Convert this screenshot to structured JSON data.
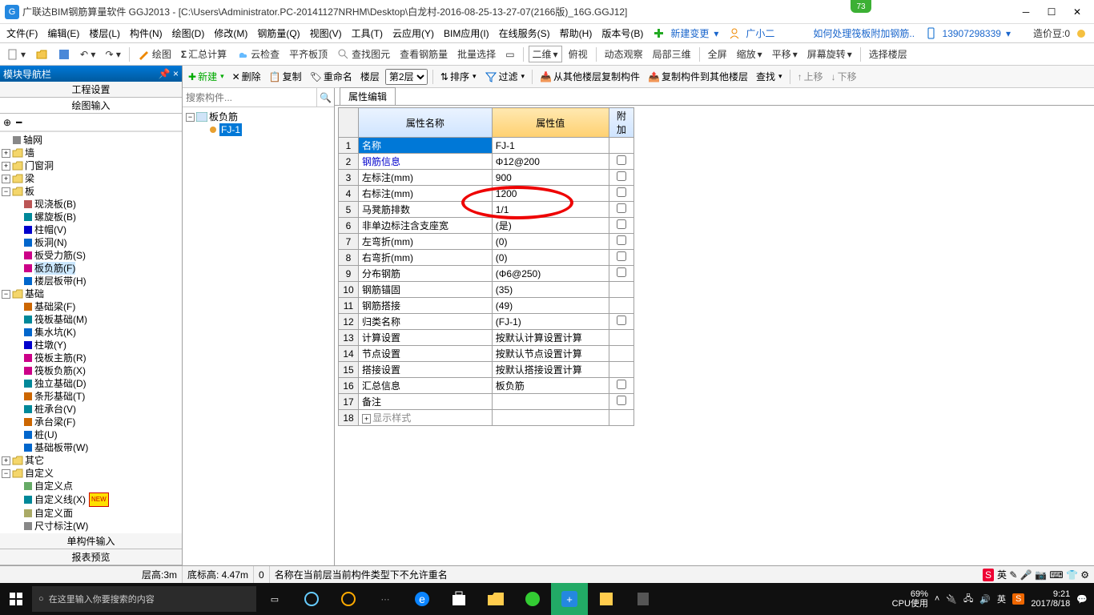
{
  "title": "广联达BIM钢筋算量软件 GGJ2013 - [C:\\Users\\Administrator.PC-20141127NRHM\\Desktop\\白龙村-2016-08-25-13-27-07(2166版)_16G.GGJ12]",
  "badge_top": "73",
  "menu": [
    "文件(F)",
    "编辑(E)",
    "楼层(L)",
    "构件(N)",
    "绘图(D)",
    "修改(M)",
    "钢筋量(Q)",
    "视图(V)",
    "工具(T)",
    "云应用(Y)",
    "BIM应用(I)",
    "在线服务(S)",
    "帮助(H)",
    "版本号(B)"
  ],
  "menu_right": {
    "newchange": "新建变更",
    "user": "广小二",
    "help_link": "如何处理筏板附加钢筋..",
    "phone": "13907298339",
    "beans": "造价豆:0"
  },
  "toolbar1": {
    "draw": "绘图",
    "sumcalc": "汇总计算",
    "cloudcheck": "云检查",
    "flattop": "平齐板顶",
    "viewimg": "查找图元",
    "viewrebar": "查看钢筋量",
    "batchsel": "批量选择",
    "two_d": "二维",
    "overlook": "俯视",
    "dynview": "动态观察",
    "partial3d": "局部三维",
    "fullscreen": "全屏",
    "zoom": "缩放",
    "pan": "平移",
    "screenrotate": "屏幕旋转",
    "selfloor": "选择楼层"
  },
  "left": {
    "header": "模块导航栏",
    "sections": [
      "工程设置",
      "绘图输入",
      "单构件输入",
      "报表预览"
    ],
    "tree": [
      {
        "lbl": "轴网",
        "icon": "grid"
      },
      {
        "lbl": "墙",
        "exp": "+"
      },
      {
        "lbl": "门窗洞",
        "exp": "+"
      },
      {
        "lbl": "梁",
        "exp": "+"
      },
      {
        "lbl": "板",
        "exp": "-",
        "children": [
          {
            "lbl": "现浇板(B)",
            "c": "#b55"
          },
          {
            "lbl": "螺旋板(B)",
            "c": "#089"
          },
          {
            "lbl": "柱帽(V)",
            "c": "#00c"
          },
          {
            "lbl": "板洞(N)",
            "c": "#06c"
          },
          {
            "lbl": "板受力筋(S)",
            "c": "#c08"
          },
          {
            "lbl": "板负筋(F)",
            "c": "#c08",
            "sel": true
          },
          {
            "lbl": "楼层板带(H)",
            "c": "#06c"
          }
        ]
      },
      {
        "lbl": "基础",
        "exp": "-",
        "children": [
          {
            "lbl": "基础梁(F)",
            "c": "#c60"
          },
          {
            "lbl": "筏板基础(M)",
            "c": "#089"
          },
          {
            "lbl": "集水坑(K)",
            "c": "#06c"
          },
          {
            "lbl": "柱墩(Y)",
            "c": "#00c"
          },
          {
            "lbl": "筏板主筋(R)",
            "c": "#c08"
          },
          {
            "lbl": "筏板负筋(X)",
            "c": "#c08"
          },
          {
            "lbl": "独立基础(D)",
            "c": "#089"
          },
          {
            "lbl": "条形基础(T)",
            "c": "#c60"
          },
          {
            "lbl": "桩承台(V)",
            "c": "#089"
          },
          {
            "lbl": "承台梁(F)",
            "c": "#c60"
          },
          {
            "lbl": "桩(U)",
            "c": "#06c"
          },
          {
            "lbl": "基础板带(W)",
            "c": "#06c"
          }
        ]
      },
      {
        "lbl": "其它",
        "exp": "+"
      },
      {
        "lbl": "自定义",
        "exp": "-",
        "children": [
          {
            "lbl": "自定义点",
            "c": "#6a6"
          },
          {
            "lbl": "自定义线(X)",
            "c": "#089",
            "new": true
          },
          {
            "lbl": "自定义面",
            "c": "#aa6"
          },
          {
            "lbl": "尺寸标注(W)",
            "c": "#888"
          }
        ]
      }
    ]
  },
  "center": {
    "search_ph": "搜索构件...",
    "root": "板负筋",
    "item": "FJ-1"
  },
  "rtoolbar": {
    "new": "新建",
    "del": "删除",
    "copy": "复制",
    "rename": "重命名",
    "floor": "楼层",
    "floor_sel": "第2层",
    "sort": "排序",
    "filter": "过滤",
    "copyfrom": "从其他楼层复制构件",
    "copyto": "复制构件到其他楼层",
    "find": "查找",
    "up": "上移",
    "down": "下移"
  },
  "tab": "属性编辑",
  "prop_headers": {
    "name": "属性名称",
    "value": "属性值",
    "extra": "附加"
  },
  "props": [
    {
      "n": "名称",
      "v": "FJ-1",
      "sel": true
    },
    {
      "n": "钢筋信息",
      "v": "Φ12@200",
      "chk": true,
      "blue": true
    },
    {
      "n": "左标注(mm)",
      "v": "900",
      "chk": true
    },
    {
      "n": "右标注(mm)",
      "v": "1200",
      "chk": true
    },
    {
      "n": "马凳筋排数",
      "v": "1/1",
      "chk": true
    },
    {
      "n": "非单边标注含支座宽",
      "v": "(是)",
      "chk": true
    },
    {
      "n": "左弯折(mm)",
      "v": "(0)",
      "chk": true
    },
    {
      "n": "右弯折(mm)",
      "v": "(0)",
      "chk": true
    },
    {
      "n": "分布钢筋",
      "v": "(Φ6@250)",
      "chk": true
    },
    {
      "n": "钢筋锚固",
      "v": "(35)"
    },
    {
      "n": "钢筋搭接",
      "v": "(49)"
    },
    {
      "n": "归类名称",
      "v": "(FJ-1)",
      "chk": true
    },
    {
      "n": "计算设置",
      "v": "按默认计算设置计算"
    },
    {
      "n": "节点设置",
      "v": "按默认节点设置计算"
    },
    {
      "n": "搭接设置",
      "v": "按默认搭接设置计算"
    },
    {
      "n": "汇总信息",
      "v": "板负筋",
      "chk": true
    },
    {
      "n": "备注",
      "v": "",
      "chk": true
    },
    {
      "n": "显示样式",
      "v": "",
      "expand": "+",
      "dim": true
    }
  ],
  "status": {
    "h": "层高:3m",
    "bh": "底标高: 4.47m",
    "zero": "0",
    "msg": "名称在当前层当前构件类型下不允许重名"
  },
  "taskbar": {
    "search": "在这里输入你要搜索的内容",
    "cpu_pct": "69%",
    "cpu_lbl": "CPU使用",
    "ime": "英",
    "time": "9:21",
    "date": "2017/8/18"
  }
}
